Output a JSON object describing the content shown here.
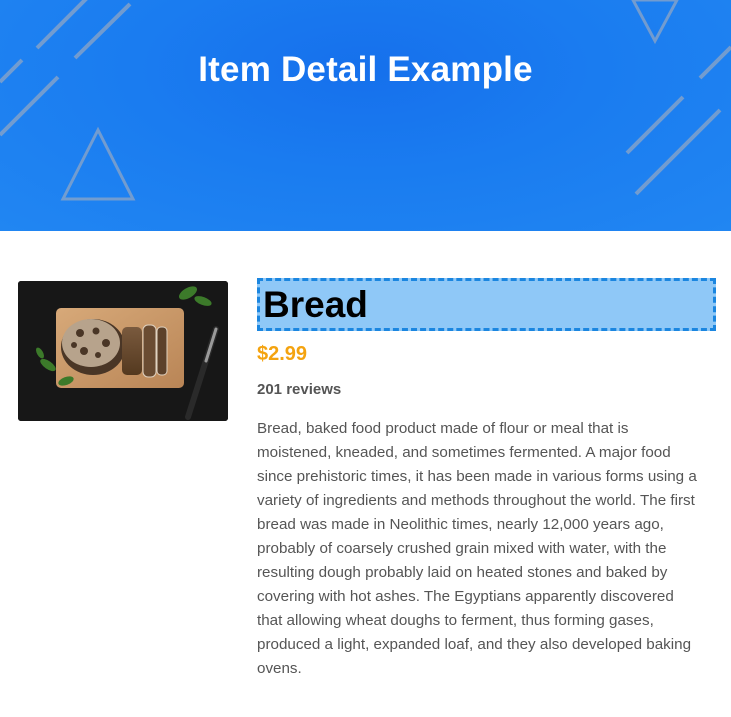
{
  "header": {
    "title": "Item Detail Example",
    "background_color": "#1a7cf0"
  },
  "product": {
    "image_icon": "bread-photo",
    "name": "Bread",
    "price": "$2.99",
    "reviews": "201 reviews",
    "description": "Bread, baked food product made of flour or meal that is moistened, kneaded, and sometimes fermented. A major food since prehistoric times, it has been made in various forms using a variety of ingredients and methods throughout the world. The first bread was made in Neolithic times, nearly 12,000 years ago, probably of coarsely crushed grain mixed with water, with the resulting dough probably laid on heated stones and baked by covering with hot ashes. The Egyptians apparently discovered that allowing wheat doughs to ferment, thus forming gases, produced a light, expanded loaf, and they also developed baking ovens.",
    "price_color": "#f4a30f",
    "highlight_color": "#8fc8f7"
  }
}
